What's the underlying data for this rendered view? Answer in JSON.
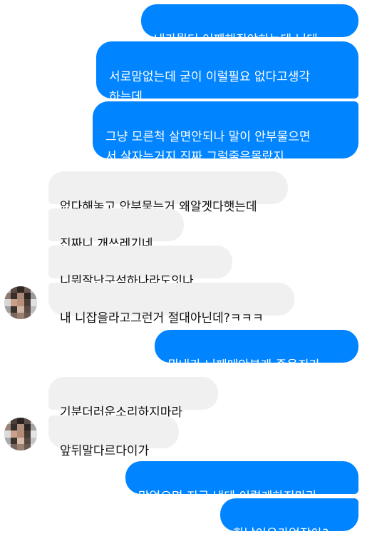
{
  "conversation": {
    "messages": [
      {
        "id": 1,
        "sender": "me",
        "text": "내가뭘더 어째해줘야하는데 닌테"
      },
      {
        "id": 2,
        "sender": "me",
        "text": "서로맘없는데 굳이 이럴필요 없다고생각\n하는데"
      },
      {
        "id": 3,
        "sender": "me",
        "text": "그냥 모른척 살면안되나 말이 안부물으면\n서 살자는거지 진짜 그럴줄은몰랐지"
      },
      {
        "id": 4,
        "sender": "other",
        "text": "없다해놓고 안부묻는거 왜알겟다햇는데"
      },
      {
        "id": 5,
        "sender": "other",
        "text": "진짜니 개쓰레기네"
      },
      {
        "id": 6,
        "sender": "other",
        "text": "니뭐잘난구석하나라도잇나"
      },
      {
        "id": 7,
        "sender": "other",
        "text": "내 니잡을라고그런거 절대아닌데?ㅋㅋㅋ"
      },
      {
        "id": 8,
        "sender": "me",
        "text": "뭐내가 니페메안본게 죽을죄가"
      },
      {
        "id": 9,
        "sender": "other",
        "text": "기분더러운소리하지마라"
      },
      {
        "id": 10,
        "sender": "other",
        "text": "앞뒤말다르다이가"
      },
      {
        "id": 11,
        "sender": "me",
        "text": "맘없으면 지금 낸테 이렇게하지마라"
      },
      {
        "id": 12,
        "sender": "me",
        "text": "화날이유가없잖아?"
      }
    ]
  },
  "colors": {
    "outgoing_bubble": "#0084ff",
    "incoming_bubble": "#f1f0f0",
    "outgoing_text": "#ffffff",
    "incoming_text": "#111111",
    "background": "#ffffff"
  },
  "icons": {
    "avatar": "pixelated-profile-avatar-icon"
  }
}
